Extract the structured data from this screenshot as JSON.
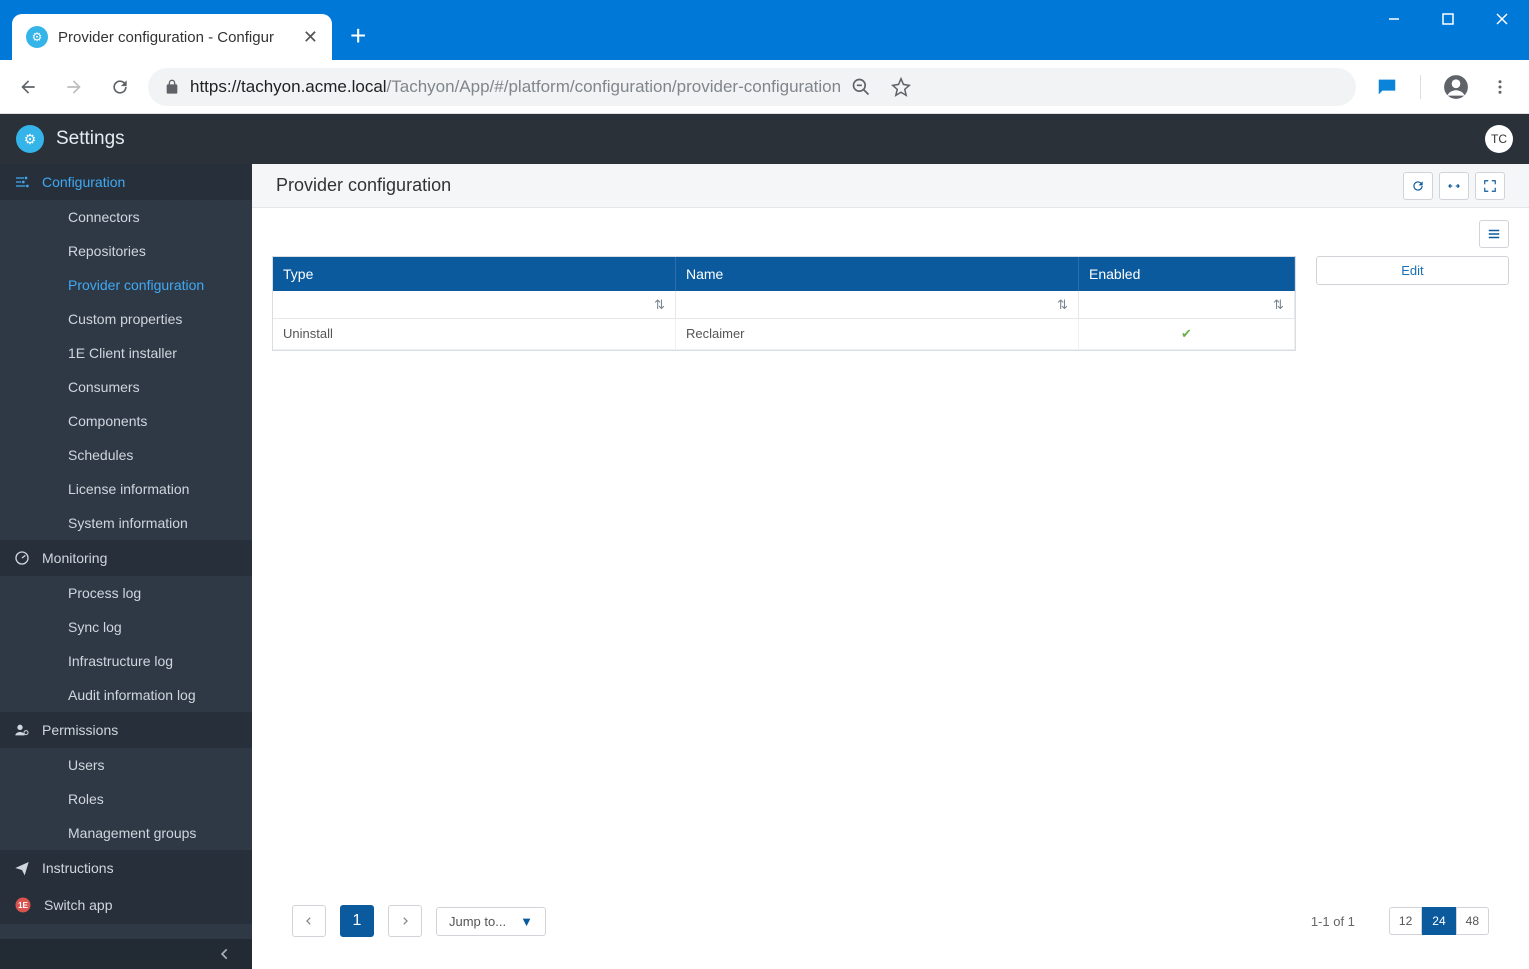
{
  "browser": {
    "tab_title": "Provider configuration - Configur",
    "url_host": "https://tachyon.acme.local",
    "url_path": "/Tachyon/App/#/platform/configuration/provider-configuration"
  },
  "header": {
    "app_title": "Settings",
    "user_initials": "TC"
  },
  "sidebar": {
    "sections": [
      {
        "label": "Configuration",
        "active": true,
        "items": [
          {
            "label": "Connectors"
          },
          {
            "label": "Repositories"
          },
          {
            "label": "Provider configuration",
            "active": true
          },
          {
            "label": "Custom properties"
          },
          {
            "label": "1E Client installer"
          },
          {
            "label": "Consumers"
          },
          {
            "label": "Components"
          },
          {
            "label": "Schedules"
          },
          {
            "label": "License information"
          },
          {
            "label": "System information"
          }
        ]
      },
      {
        "label": "Monitoring",
        "items": [
          {
            "label": "Process log"
          },
          {
            "label": "Sync log"
          },
          {
            "label": "Infrastructure log"
          },
          {
            "label": "Audit information log"
          }
        ]
      },
      {
        "label": "Permissions",
        "items": [
          {
            "label": "Users"
          },
          {
            "label": "Roles"
          },
          {
            "label": "Management groups"
          }
        ]
      },
      {
        "label": "Instructions",
        "items": []
      },
      {
        "label": "Switch app",
        "items": []
      }
    ]
  },
  "page": {
    "title": "Provider configuration",
    "edit_label": "Edit"
  },
  "table": {
    "columns": {
      "type": "Type",
      "name": "Name",
      "enabled": "Enabled"
    },
    "rows": [
      {
        "type": "Uninstall",
        "name": "Reclaimer",
        "enabled": true
      }
    ]
  },
  "pager": {
    "current": "1",
    "jump_label": "Jump to...",
    "info": "1-1 of 1",
    "sizes": [
      "12",
      "24",
      "48"
    ],
    "active_size": "24"
  }
}
